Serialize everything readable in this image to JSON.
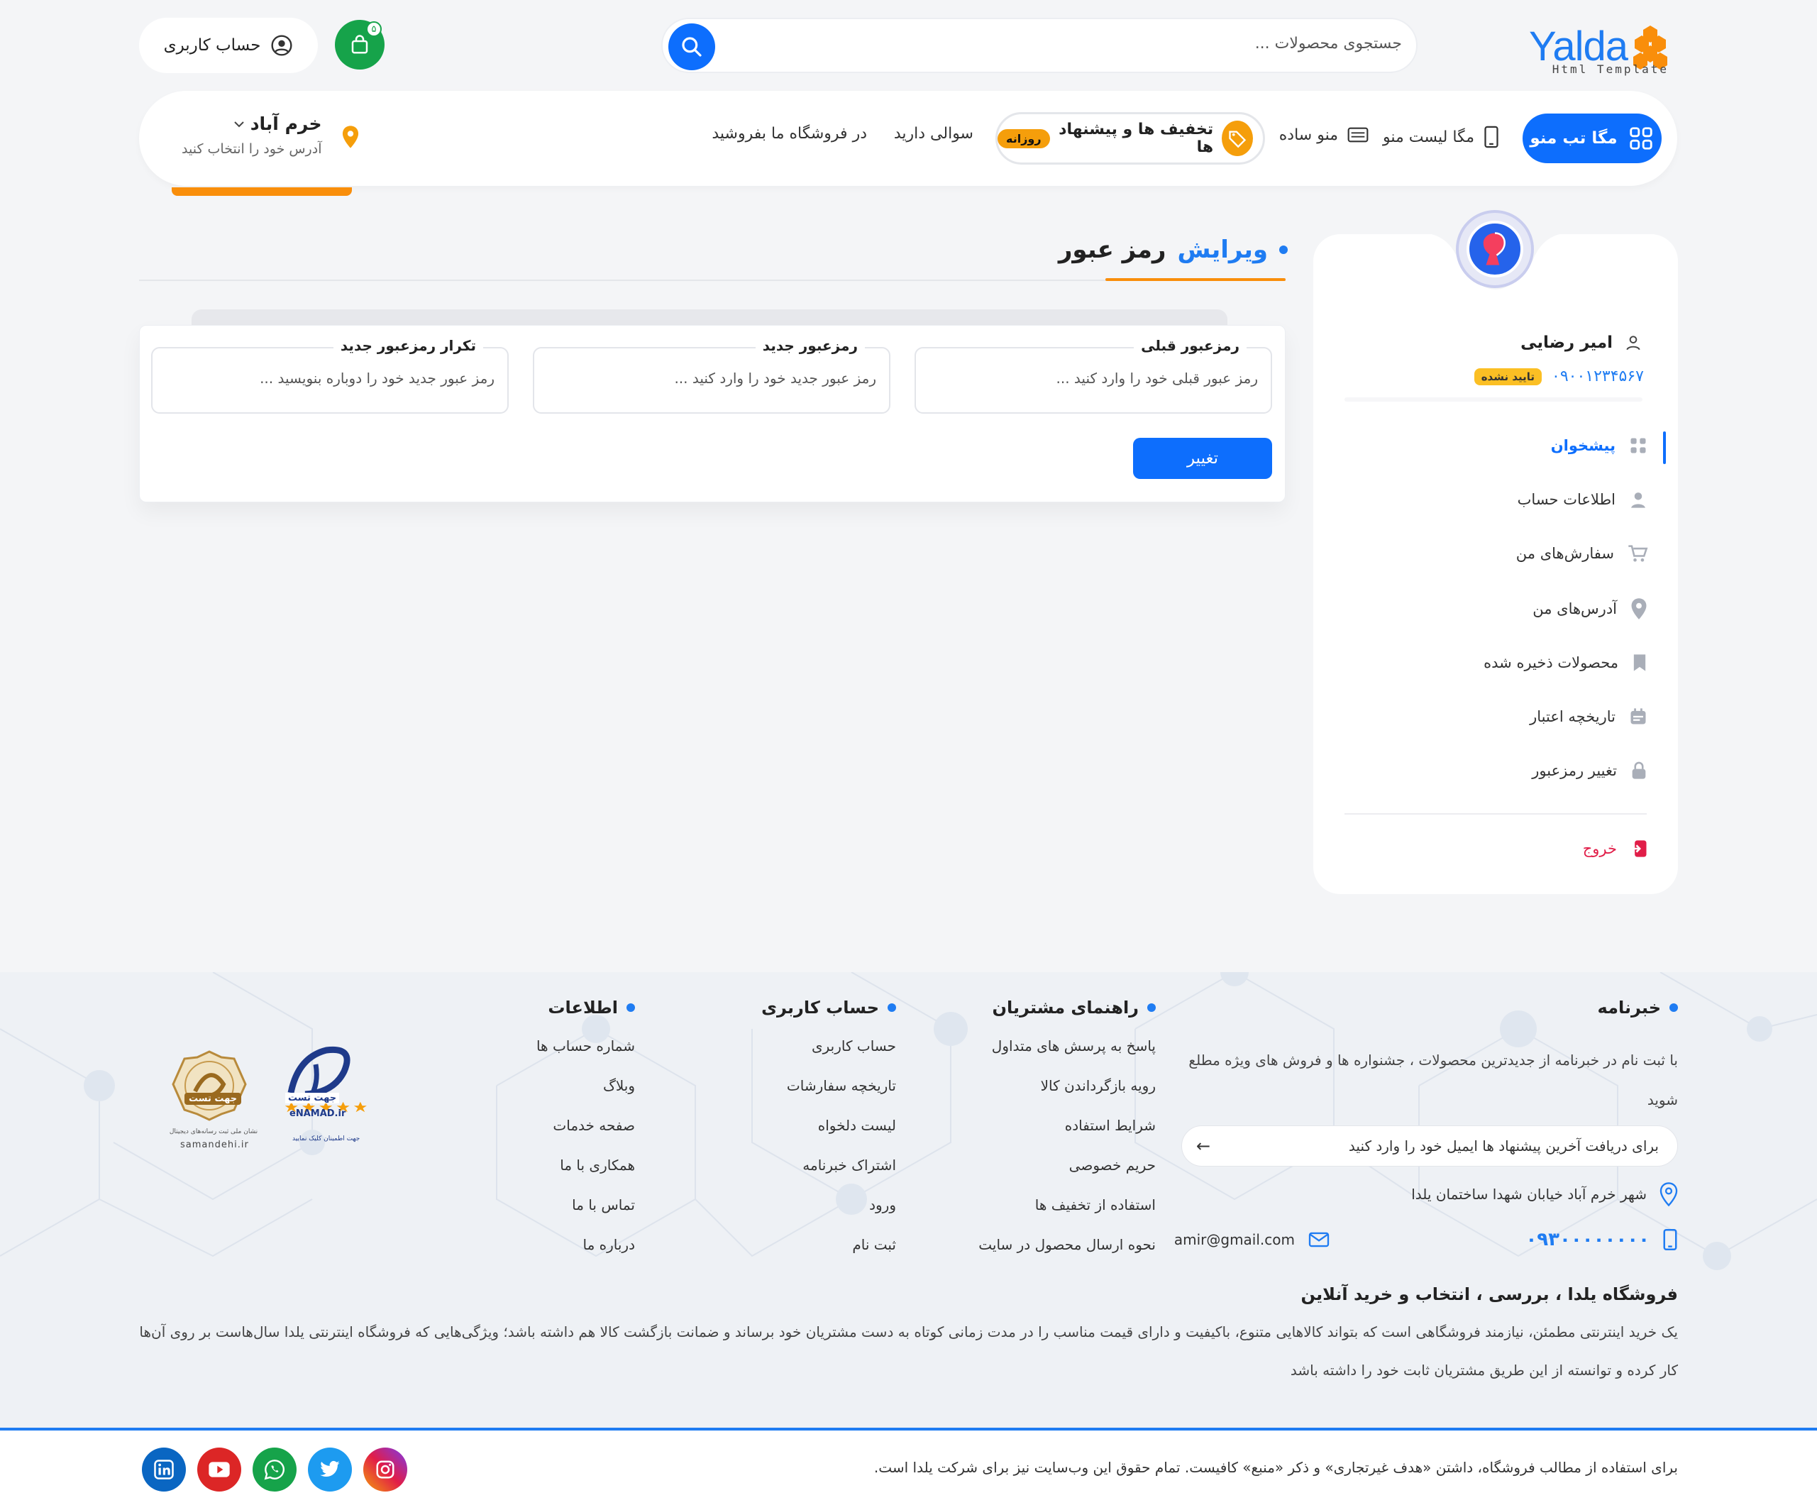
{
  "header": {
    "logo": {
      "name": "Yalda",
      "subtitle": "Html Template"
    },
    "search_placeholder": "جستجوی محصولات ...",
    "cart_count": "۵",
    "account_label": "حساب کاربری"
  },
  "nav": {
    "mega_tab": "مگا تب منو",
    "mega_list": "مگا لیست منو",
    "simple_menu": "منو ساده",
    "deals": "تخفیف ها و پیشنهاد ها",
    "deals_badge": "روزانه",
    "question": "سوالی دارید",
    "sell": "در فروشگاه ما بفروشید",
    "location_city": "خرم آباد",
    "location_hint": "آدرس خود را انتخاب کنید"
  },
  "profile": {
    "name": "امیر رضایی",
    "phone": "۰۹۰۰۱۲۳۴۵۶۷",
    "status": "تایید نشده"
  },
  "menu": [
    {
      "label": "پیشخوان",
      "icon": "dashboard-icon",
      "active": true
    },
    {
      "label": "اطلاعات حساب",
      "icon": "user-icon"
    },
    {
      "label": "سفارش‌های من",
      "icon": "cart-icon"
    },
    {
      "label": "آدرس‌های من",
      "icon": "location-icon"
    },
    {
      "label": "محصولات ذخیره شده",
      "icon": "bookmark-icon"
    },
    {
      "label": "تاریخچه اعتبار",
      "icon": "calendar-icon"
    },
    {
      "label": "تغییر رمزعبور",
      "icon": "lock-icon"
    }
  ],
  "logout": "خروج",
  "page": {
    "title_blue": "ویرایش",
    "title_dark": "رمز عبور"
  },
  "form": {
    "old": {
      "label": "رمزعبور قبلی",
      "placeholder": "رمز عبور قبلی خود را وارد کنید ..."
    },
    "new": {
      "label": "رمزعبور جدید",
      "placeholder": "رمز عبور جدید خود را وارد کنید ..."
    },
    "repeat": {
      "label": "تکرار رمزعبور جدید",
      "placeholder": "رمز عبور جدید خود را دوباره بنویسید ..."
    },
    "submit": "تغییر"
  },
  "footer": {
    "newsletter": {
      "title": "خبرنامه",
      "text": "با ثبت نام در خبرنامه از جدیدترین محصولات ، جشنواره ها و فروش های ویژه مطلع شوید",
      "email_placeholder": "برای دریافت آخرین پیشنهاد ها ایمیل خود را وارد کنید"
    },
    "address": "شهر خرم آباد خیابان شهدا ساختمان یلدا",
    "email": "amir@gmail.com",
    "phone": "۰۹۳۰۰۰۰۰۰۰۰",
    "guide": {
      "title": "راهنمای مشتریان",
      "links": [
        "پاسخ به پرسش های متداول",
        "رویه بازگرداندن کالا",
        "شرایط استفاده",
        "حریم خصوصی",
        "استفاده از تخفیف ها",
        "نحوه ارسال محصول در سایت"
      ]
    },
    "account": {
      "title": "حساب کاربری",
      "links": [
        "حساب کاربری",
        "تاریخچه سفارشات",
        "لیست دلخواه",
        "اشتراک خبرنامه",
        "ورود",
        "ثبت نام"
      ]
    },
    "info": {
      "title": "اطلاعات",
      "links": [
        "شماره حساب ها",
        "وبلاگ",
        "صفحه خدمات",
        "همکاری با ما",
        "تماس با ما",
        "درباره ما"
      ]
    },
    "badges": {
      "enamad_top": "جهت تست",
      "enamad_site": "eNAMAD.ir",
      "enamad_note": "جهت اطمینان کلیک نمایید",
      "samandehi_top": "جهت تست",
      "samandehi_note": "نشان ملی ثبت رسانه‌های دیجیتال",
      "samandehi_site": "samandehi.ir"
    },
    "store_title": "فروشگاه یلدا ، بررسی ، انتخاب و خرید آنلاین",
    "store_desc": "یک خرید اینترنتی مطمئن، نیازمند فروشگاهی است که بتواند کالاهایی متنوع، باکیفیت و دارای قیمت مناسب را در مدت زمانی کوتاه به دست مشتریان خود برساند و ضمانت بازگشت کالا هم داشته باشد؛ ویژگی‌هایی که فروشگاه اینترنتی یلدا سال‌هاست بر روی آن‌ها کار کرده و توانسته از این طریق مشتریان ثابت خود را داشته باشد",
    "copyright": "برای استفاده از مطالب فروشگاه، داشتن «هدف غیرتجاری» و ذکر «منبع» کافیست. تمام حقوق این وب‌سایت نیز برای شرکت یلدا است."
  },
  "colors": {
    "primary": "#0d6efd",
    "accent": "#f98e0b",
    "cart": "#16a34a",
    "danger": "#e11d48"
  }
}
